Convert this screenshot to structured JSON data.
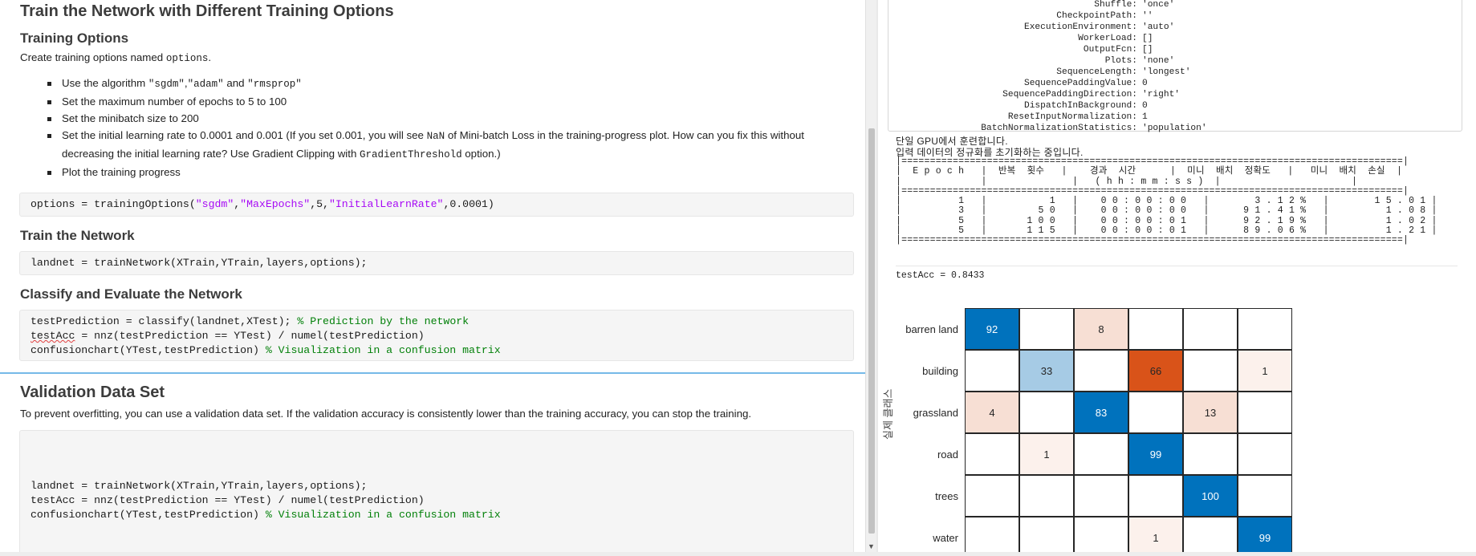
{
  "left": {
    "title": "Train the Network with Different Training Options",
    "training_options": {
      "heading": "Training Options",
      "intro_prefix": "Create training options named ",
      "intro_code": "options",
      "intro_suffix": ".",
      "bullets": [
        {
          "pre": "Use the algorithm ",
          "code1": "\"sgdm\"",
          "mid1": ",",
          "code2": "\"adam\"",
          "mid2": " and ",
          "code3": "\"rmsprop\""
        },
        {
          "text": "Set the maximum number of epochs to 5 to 100"
        },
        {
          "text": "Set the minibatch size to 200"
        },
        {
          "pre": "Set the initial learning rate to 0.0001 and 0.001 (If you set 0.001, you will see ",
          "code": "NaN",
          "post": " of Mini-batch Loss in the training-progress plot. How can you fix this without"
        },
        {
          "pre": "decreasing the initial learning rate? Use Gradient Clipping with ",
          "code": "GradientThreshold",
          "post": " option.)"
        },
        {
          "text": "Plot the training progress"
        }
      ],
      "code": {
        "p1": "options = trainingOptions(",
        "s1": "\"sgdm\"",
        "p2": ",",
        "s2": "\"MaxEpochs\"",
        "p3": ",5,",
        "s3": "\"InitialLearnRate\"",
        "p4": ",0.0001)"
      }
    },
    "train": {
      "heading": "Train the Network",
      "code": "landnet = trainNetwork(XTrain,YTrain,layers,options);"
    },
    "classify": {
      "heading": "Classify and Evaluate the Network",
      "line1_code": "testPrediction = classify(landnet,XTest); ",
      "line1_comment": "% Prediction by the network",
      "line2_a": "testAcc",
      "line2_b": " = nnz(testPrediction == YTest) / numel(testPrediction)",
      "line3_code": "confusionchart(YTest,testPrediction) ",
      "line3_comment": "% Visualization in a confusion matrix"
    },
    "validation": {
      "heading": "Validation Data Set",
      "text": "To prevent overfitting, you can use a validation data set. If the validation accuracy is consistently lower than the training accuracy, you can stop the training.",
      "line1": "landnet = trainNetwork(XTrain,YTrain,layers,options);",
      "line2": "testAcc = nnz(testPrediction == YTest) / numel(testPrediction)",
      "line3_code": "confusionchart(YTest,testPrediction) ",
      "line3_comment": "% Visualization in a confusion matrix"
    }
  },
  "right": {
    "options": [
      {
        "k": "Shuffle:",
        "v": "'once'"
      },
      {
        "k": "CheckpointPath:",
        "v": "''"
      },
      {
        "k": "ExecutionEnvironment:",
        "v": "'auto'"
      },
      {
        "k": "WorkerLoad:",
        "v": "[]"
      },
      {
        "k": "OutputFcn:",
        "v": "[]"
      },
      {
        "k": "Plots:",
        "v": "'none'"
      },
      {
        "k": "SequenceLength:",
        "v": "'longest'"
      },
      {
        "k": "SequencePaddingValue:",
        "v": "0"
      },
      {
        "k": "SequencePaddingDirection:",
        "v": "'right'"
      },
      {
        "k": "DispatchInBackground:",
        "v": "0"
      },
      {
        "k": "ResetInputNormalization:",
        "v": "1"
      },
      {
        "k": "BatchNormalizationStatistics:",
        "v": "'population'"
      }
    ],
    "msg1": "단일 GPU에서 훈련합니다.",
    "msg2": "입력 데이터의 정규화를 초기화하는 중입니다.",
    "table_text": "|========================================================================================|\n|  E p o c h   |  반복  횟수   |    경과  시간      |  미니  배치  정확도   |   미니  배치  손실  |\n|              |               |   ( h h : m m : s s )  |                       |                     |\n|========================================================================================|\n|          1   |           1   |    0 0 : 0 0 : 0 0   |        3 . 1 2 %   |        1 5 . 0 1 |\n|          3   |         5 0   |    0 0 : 0 0 : 0 0   |      9 1 . 4 1 %   |          1 . 0 8 |\n|          5   |       1 0 0   |    0 0 : 0 0 : 0 1   |      9 2 . 1 9 %   |          1 . 0 2 |\n|          5   |       1 1 5   |    0 0 : 0 0 : 0 1   |      8 9 . 0 6 %   |          1 . 2 1 |\n|========================================================================================|",
    "testacc": "testAcc = 0.8433",
    "confusion": {
      "row_labels": [
        "barren land",
        "building",
        "grassland",
        "road",
        "trees",
        "water"
      ],
      "y_axis_label": "실제 클래스",
      "matrix": [
        [
          92,
          null,
          8,
          null,
          null,
          null
        ],
        [
          null,
          33,
          null,
          66,
          null,
          1
        ],
        [
          4,
          null,
          83,
          null,
          13,
          null
        ],
        [
          null,
          1,
          null,
          99,
          null,
          null
        ],
        [
          null,
          null,
          null,
          null,
          100,
          null
        ],
        [
          null,
          null,
          null,
          1,
          null,
          99
        ]
      ],
      "colors": {
        "diag_strong": "#0072BD",
        "diag_light": "#A6CBE5",
        "off_strong": "#D95319",
        "off_light": "#F7DFD4",
        "off_faint": "#FCF1EC"
      }
    }
  }
}
